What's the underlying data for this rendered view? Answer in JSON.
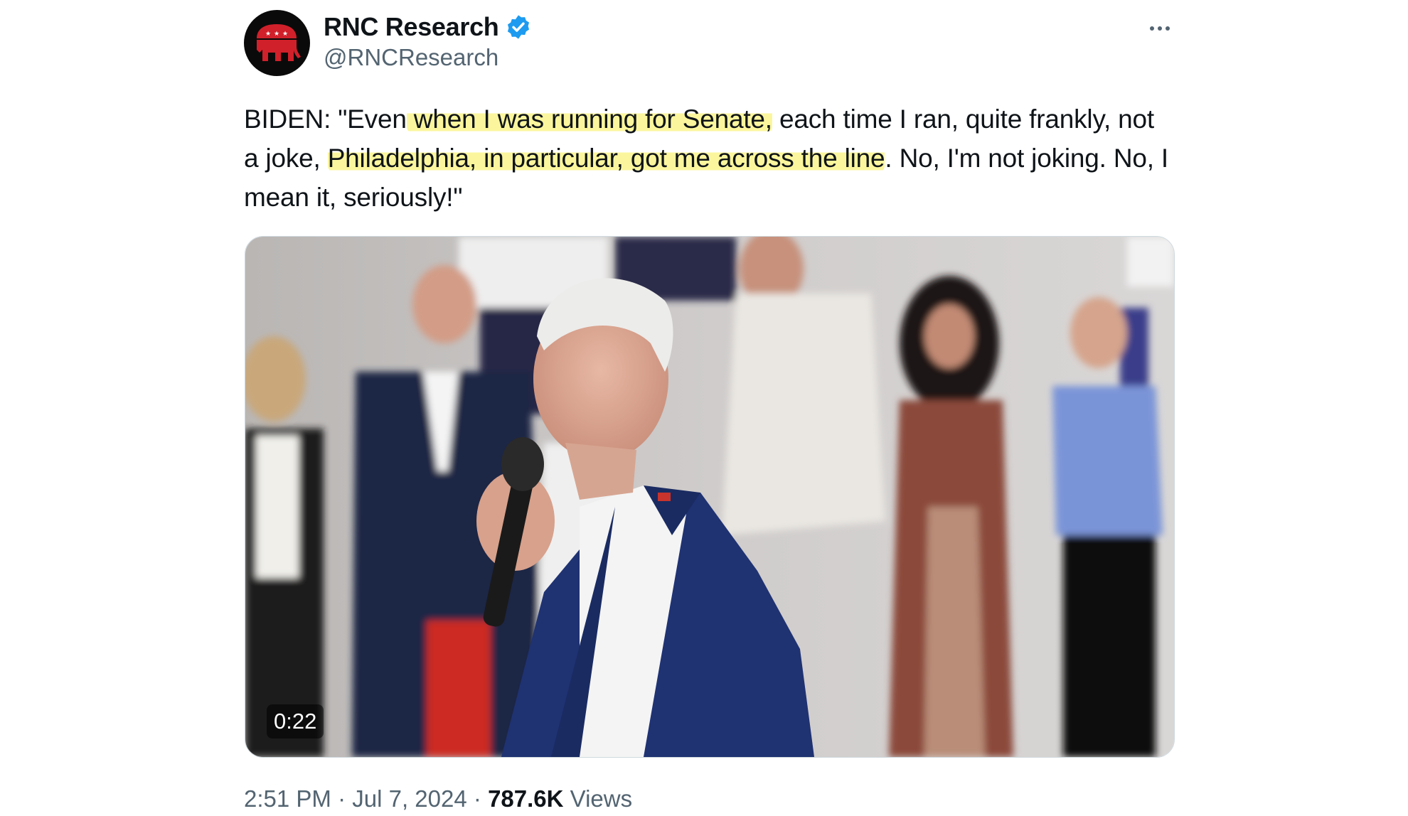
{
  "author": {
    "display_name": "RNC Research",
    "handle": "@RNCResearch",
    "avatar_icon": "gop-elephant-logo-icon",
    "verified_icon": "verified-badge-icon",
    "verified_color": "#1d9bf0"
  },
  "tweet": {
    "text_parts": [
      "BIDEN: \"Even",
      " when I was running for Senate,",
      " each time I ran, quite frankly, not a joke, ",
      "Philadelphia, in particular, got me across the line",
      ". No, I'm not joking. No, I mean it, seriously!\""
    ],
    "highlight_color": "#faf48c"
  },
  "media": {
    "duration": "0:22"
  },
  "meta": {
    "time": "2:51 PM",
    "separator": "·",
    "date": "Jul 7, 2024",
    "views_count": "787.6K",
    "views_label": "Views"
  },
  "colors": {
    "primary_text": "#0f1419",
    "secondary_text": "#536471",
    "border": "#cfd9de"
  }
}
